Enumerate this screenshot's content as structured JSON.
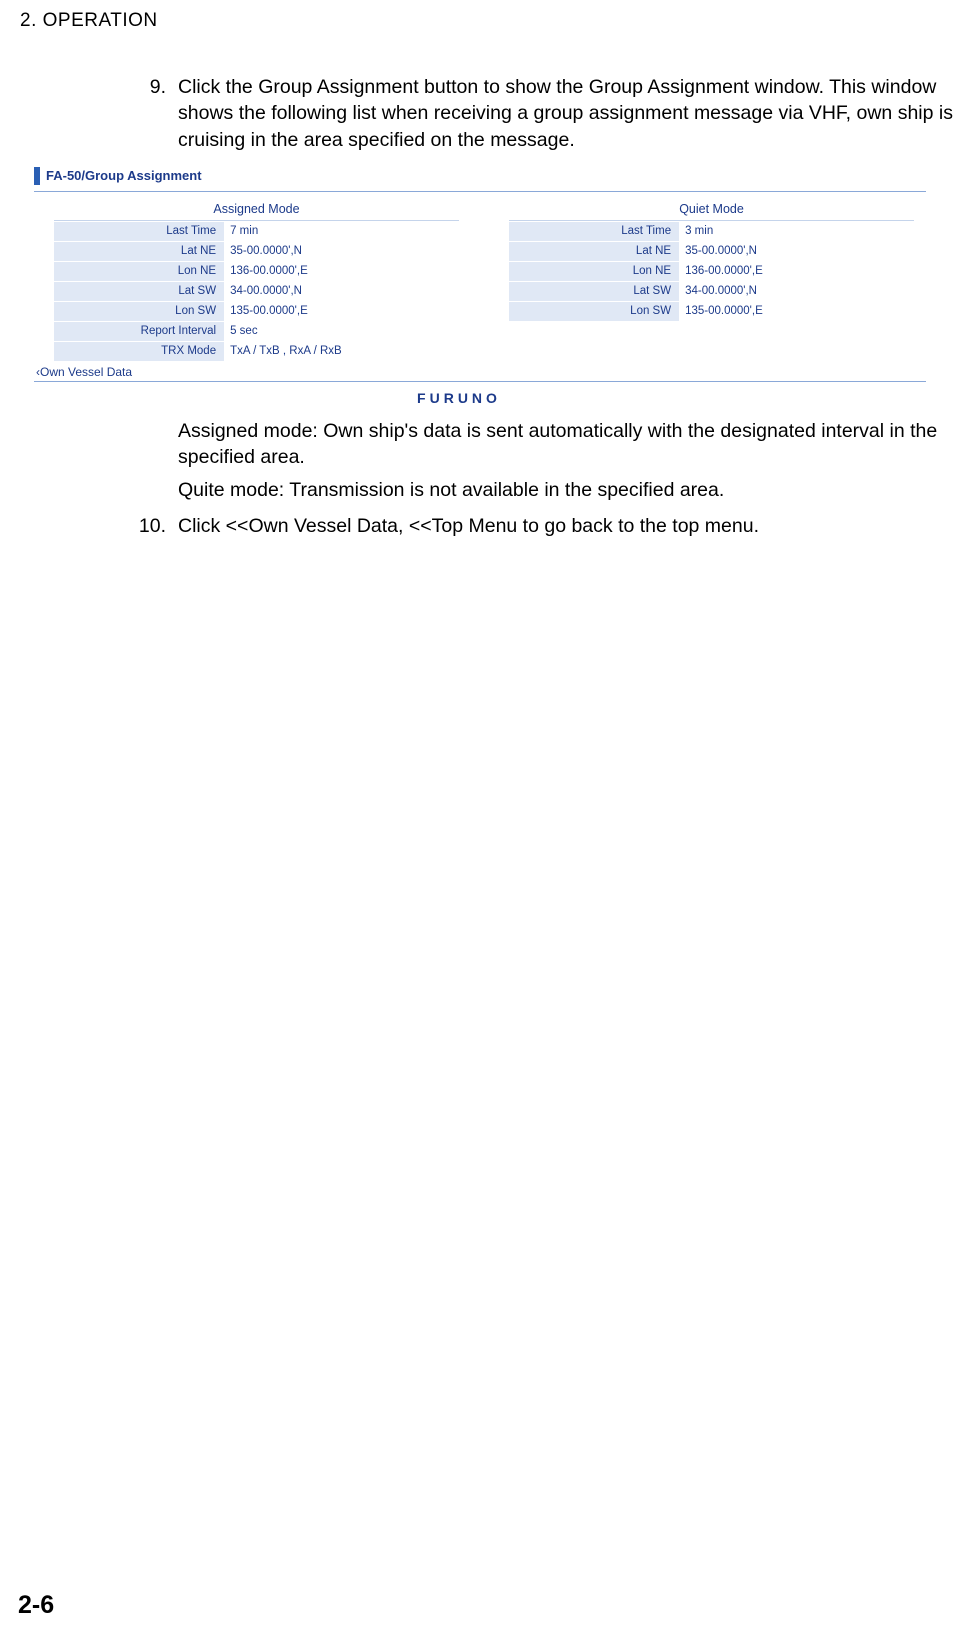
{
  "header": {
    "section_label": "2.  OPERATION"
  },
  "steps": {
    "nine": {
      "num": "9.",
      "text": "Click the Group Assignment button to show the Group Assignment window. This window shows the following list when receiving a group assignment message via VHF, own ship is cruising in the area specified on the message."
    },
    "ten": {
      "num": "10.",
      "text": "Click <<Own Vessel Data, <<Top Menu to go back to the top menu."
    }
  },
  "screenshot": {
    "title": "FA-50/Group Assignment",
    "assigned_mode": {
      "header": "Assigned Mode",
      "rows": [
        {
          "label": "Last Time",
          "value": "7 min"
        },
        {
          "label": "Lat NE",
          "value": "35-00.0000',N"
        },
        {
          "label": "Lon NE",
          "value": "136-00.0000',E"
        },
        {
          "label": "Lat SW",
          "value": "34-00.0000',N"
        },
        {
          "label": "Lon SW",
          "value": "135-00.0000',E"
        },
        {
          "label": "Report Interval",
          "value": "5 sec"
        },
        {
          "label": "TRX Mode",
          "value": "TxA / TxB , RxA / RxB"
        }
      ]
    },
    "quiet_mode": {
      "header": "Quiet Mode",
      "rows": [
        {
          "label": "Last Time",
          "value": "3 min"
        },
        {
          "label": "Lat NE",
          "value": "35-00.0000',N"
        },
        {
          "label": "Lon NE",
          "value": "136-00.0000',E"
        },
        {
          "label": "Lat SW",
          "value": "34-00.0000',N"
        },
        {
          "label": "Lon SW",
          "value": "135-00.0000',E"
        }
      ]
    },
    "own_vessel_link": "‹Own Vessel Data",
    "logo": "FURUNO"
  },
  "descriptions": {
    "assigned": "Assigned mode: Own ship's data is sent automatically with the designated interval in the specified area.",
    "quiet": "Quite mode: Transmission is not available in the specified area."
  },
  "page_number": "2-6"
}
